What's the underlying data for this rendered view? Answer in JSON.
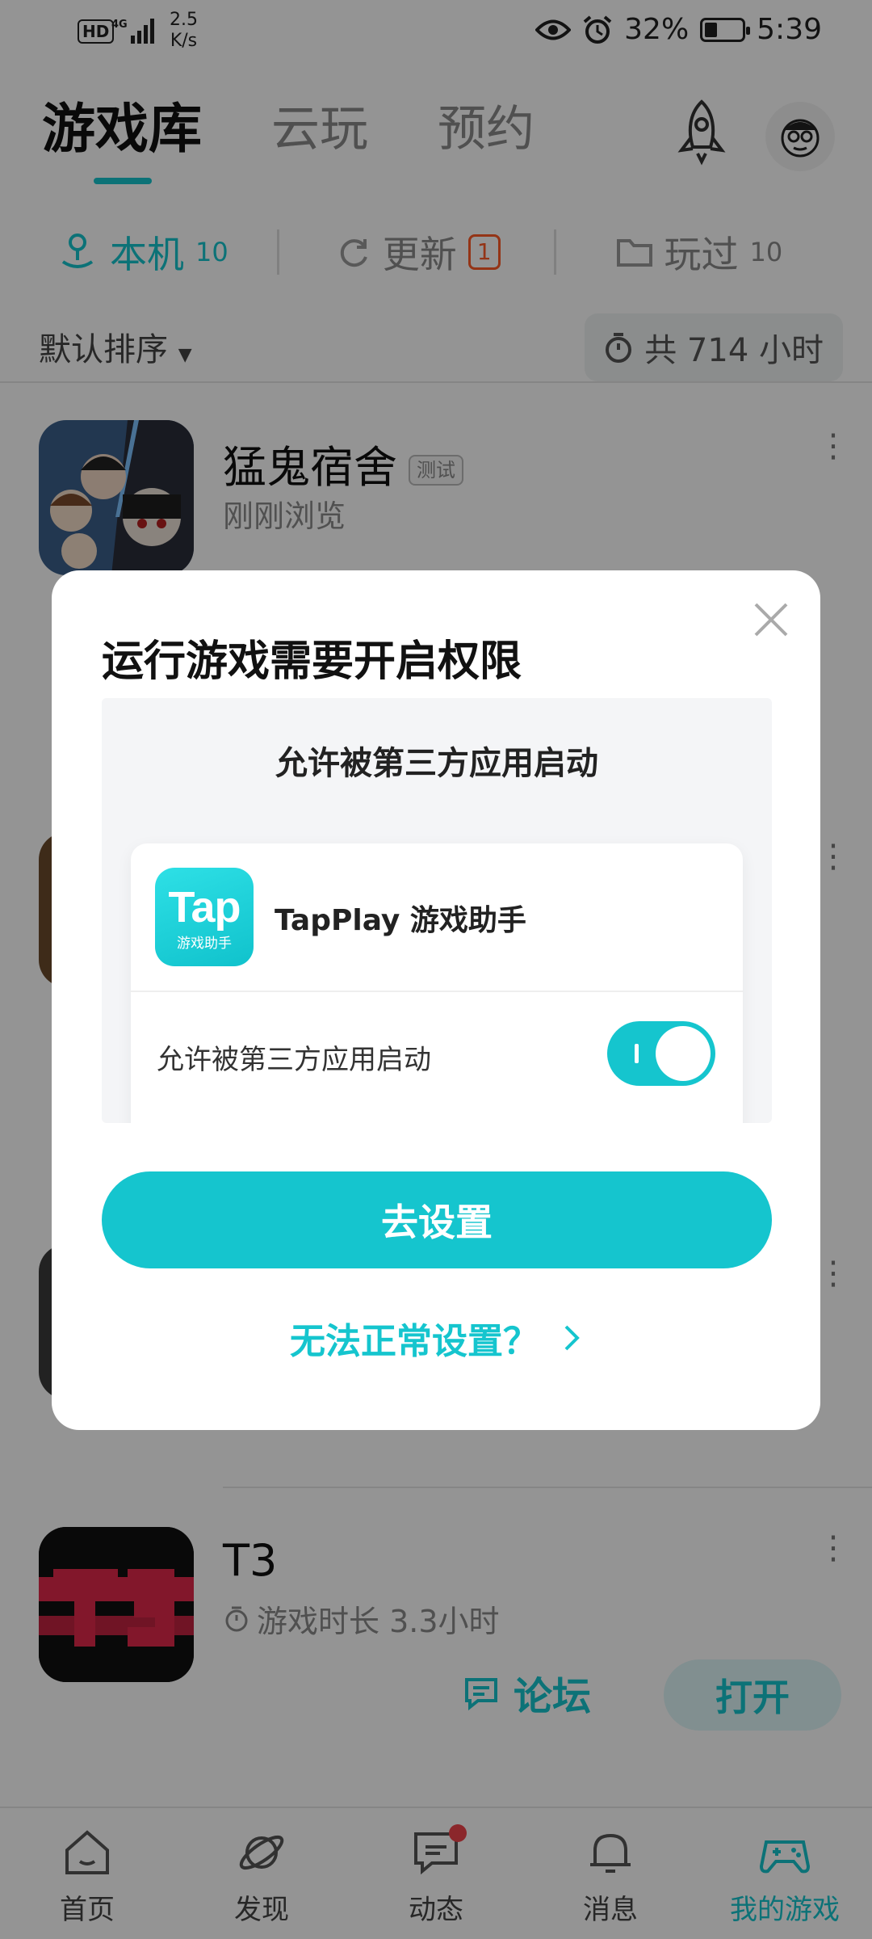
{
  "status_bar": {
    "hd": "HD",
    "network": "4G",
    "speed_value": "2.5",
    "speed_unit": "K/s",
    "battery": "32%",
    "time": "5:39"
  },
  "top_tabs": [
    {
      "label": "游戏库",
      "active": true
    },
    {
      "label": "云玩",
      "active": false
    },
    {
      "label": "预约",
      "active": false
    }
  ],
  "sub_tabs": {
    "local": {
      "label": "本机",
      "count": "10"
    },
    "update": {
      "label": "更新",
      "badge": "1"
    },
    "played": {
      "label": "玩过",
      "count": "10"
    }
  },
  "sort": {
    "label": "默认排序"
  },
  "total_hours": "共 714 小时",
  "games": [
    {
      "title": "猛鬼宿舍",
      "tag": "测试",
      "sub": "刚刚浏览"
    },
    {
      "title": "T3",
      "sub": "游戏时长 3.3小时",
      "forum": "论坛",
      "open": "打开"
    }
  ],
  "bottom_nav": [
    {
      "label": "首页",
      "icon": "home-icon"
    },
    {
      "label": "发现",
      "icon": "planet-icon"
    },
    {
      "label": "动态",
      "icon": "chat-icon"
    },
    {
      "label": "消息",
      "icon": "bell-icon"
    },
    {
      "label": "我的游戏",
      "icon": "gamepad-icon"
    }
  ],
  "dialog": {
    "title": "运行游戏需要开启权限",
    "preview_title": "允许被第三方应用启动",
    "logo_big": "Tap",
    "logo_small": "游戏助手",
    "app_name": "TapPlay 游戏助手",
    "permission_label": "允许被第三方应用启动",
    "toggle_on": true,
    "primary_button": "去设置",
    "help_link": "无法正常设置？"
  },
  "colors": {
    "accent": "#15c5ce",
    "badge": "#ff5a26",
    "overlay": "rgba(0,0,0,0.42)"
  }
}
